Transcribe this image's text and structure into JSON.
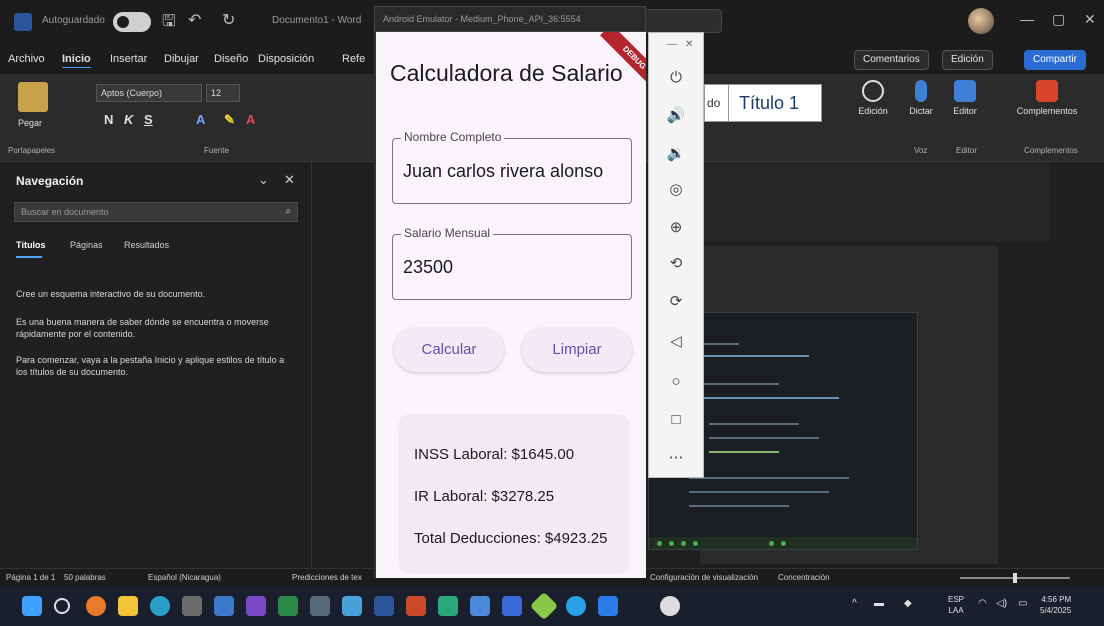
{
  "word": {
    "autosave_label": "Autoguardado",
    "doc_name": "Documento1 - Word",
    "menu": [
      "Archivo",
      "Inicio",
      "Insertar",
      "Dibujar",
      "Diseño",
      "Disposición",
      "Refe"
    ],
    "comments_btn": "Comentarios",
    "editing_btn": "Edición",
    "share_btn": "Compartir",
    "ribbon": {
      "paste": "Pegar",
      "clipboard_group": "Portapapeles",
      "font_name": "Aptos (Cuerpo)",
      "font_size": "12",
      "font_group": "Fuente",
      "style_prev": "do",
      "style_title": "Título 1",
      "editing_tool": "Edición",
      "dictate_tool": "Dictar",
      "editor_tool": "Editor",
      "addins_tool": "Complementos",
      "voice_group": "Voz",
      "editor_group": "Editor",
      "addins_group": "Complementos"
    },
    "nav": {
      "title": "Navegación",
      "search_placeholder": "Buscar en documento",
      "tabs": [
        "Títulos",
        "Páginas",
        "Resultados"
      ],
      "p1": "Cree un esquema interactivo de su documento.",
      "p2": "Es una buena manera de saber dónde se encuentra o moverse rápidamente por el contenido.",
      "p3": "Para comenzar, vaya a la pestaña Inicio y aplique estilos de título a los títulos de su documento."
    },
    "status": {
      "page": "Página 1 de 1",
      "words": "50 palabras",
      "language": "Español (Nicaragua)",
      "predictions": "Predicciones de tex",
      "display_settings": "Configuración de visualización",
      "focus": "Concentración",
      "zoom_fraction": 0.5
    }
  },
  "emulator": {
    "window_title": "Android Emulator - Medium_Phone_API_36:5554",
    "debug_banner": "DEBUG",
    "app": {
      "title": "Calculadora de Salario",
      "name_label": "Nombre Completo",
      "name_value": "Juan carlos rivera alonso",
      "salary_label": "Salario Mensual",
      "salary_value": "23500",
      "calc_button": "Calcular",
      "clear_button": "Limpiar",
      "inss": "INSS Laboral: $1645.00",
      "ir": "IR Laboral: $3278.25",
      "total": "Total Deducciones: $4923.25"
    },
    "toolbar_icons": [
      "power-icon",
      "volume-up-icon",
      "volume-down-icon",
      "camera-icon",
      "zoom-icon",
      "rotate-left-icon",
      "rotate-right-icon",
      "back-icon",
      "home-icon",
      "overview-icon",
      "more-icon"
    ]
  },
  "taskbar": {
    "lang_top": "ESP",
    "lang_bottom": "LAA",
    "time": "4:56 PM",
    "date": "5/4/2025"
  }
}
